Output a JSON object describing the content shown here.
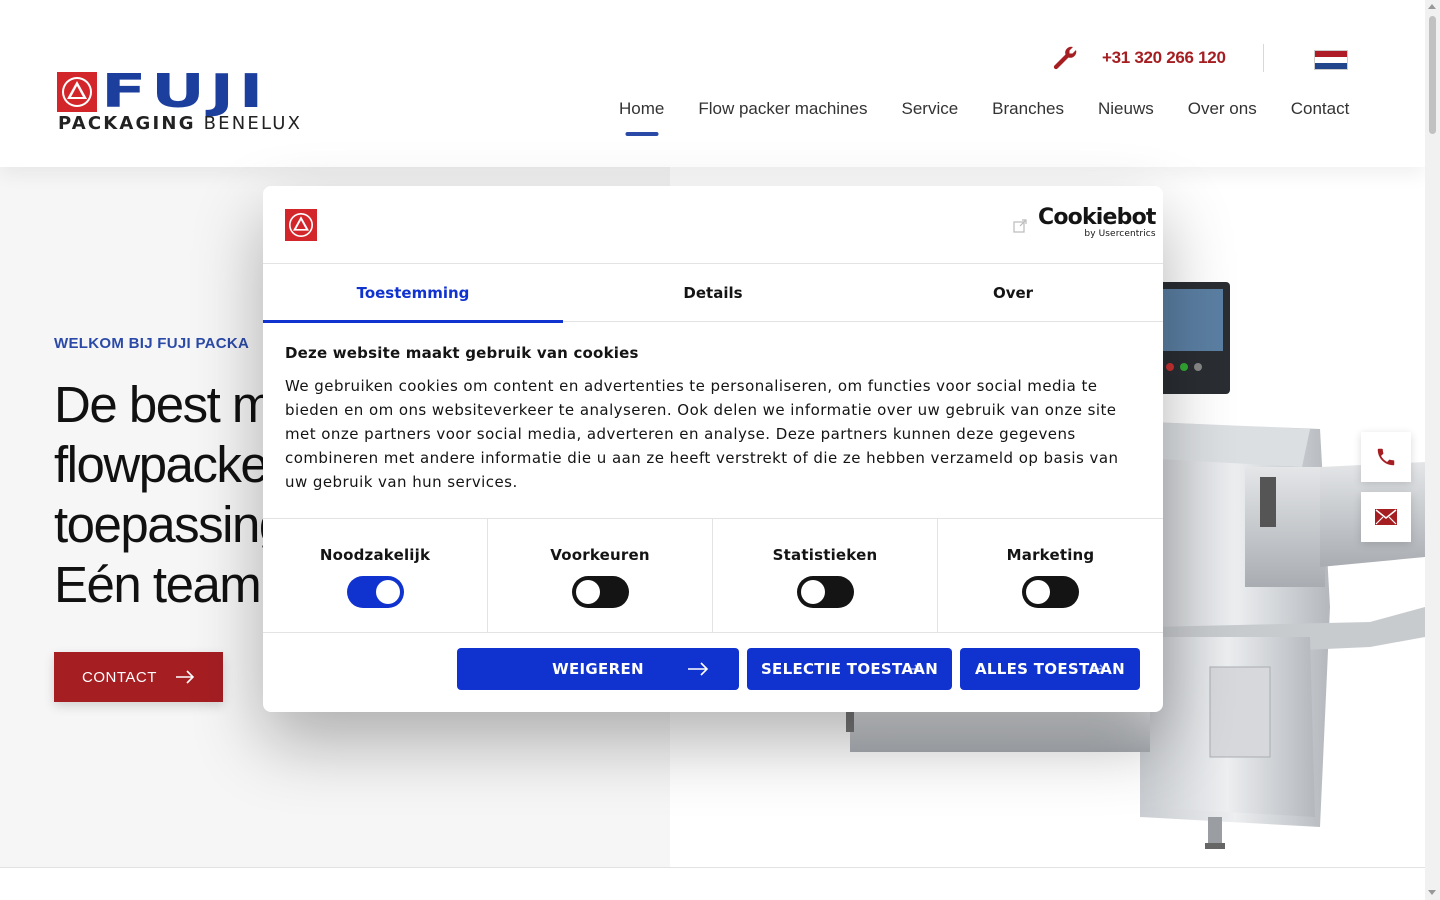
{
  "header": {
    "logo_word": "FUJI",
    "logo_sub_bold": "PACKAGING",
    "logo_sub_rest": "BENELUX",
    "phone": "+31 320 266 120",
    "nav": [
      "Home",
      "Flow packer machines",
      "Service",
      "Branches",
      "Nieuws",
      "Over ons",
      "Contact"
    ],
    "active_nav": "Home"
  },
  "hero": {
    "welcome": "WELKOM BIJ FUJI PACKA",
    "headline_lines": [
      "De best m",
      "flowpacke",
      "toepassing",
      "Eén team,"
    ],
    "contact_label": "CONTACT"
  },
  "cookie_dialog": {
    "brand": "Cookiebot",
    "brand_sub": "by Usercentrics",
    "tabs": [
      "Toestemming",
      "Details",
      "Over"
    ],
    "active_tab": "Toestemming",
    "title": "Deze website maakt gebruik van cookies",
    "text": "We gebruiken cookies om content en advertenties te personaliseren, om functies voor social media te bieden en om ons websiteverkeer te analyseren. Ook delen we informatie over uw gebruik van onze site met onze partners voor social media, adverteren en analyse. Deze partners kunnen deze gegevens combineren met andere informatie die u aan ze heeft verstrekt of die ze hebben verzameld op basis van uw gebruik van hun services.",
    "categories": [
      {
        "label": "Noodzakelijk",
        "enabled": true
      },
      {
        "label": "Voorkeuren",
        "enabled": false
      },
      {
        "label": "Statistieken",
        "enabled": false
      },
      {
        "label": "Marketing",
        "enabled": false
      }
    ],
    "buttons": {
      "deny": "WEIGEREN",
      "allow_selection": "SELECTIE TOESTAAN",
      "allow_all": "ALLES TOESTAAN"
    }
  },
  "icons": {
    "wrench": "wrench-icon",
    "phone": "phone-icon",
    "mail": "mail-icon",
    "arrow": "arrow-right-icon",
    "external": "external-link-icon",
    "flag": "flag-nl-icon"
  },
  "colors": {
    "brand_red": "#a51e22",
    "brand_blue": "#1c3f9e",
    "cookiebot_blue": "#1032cf",
    "nav_underline": "#2b4aa8"
  }
}
